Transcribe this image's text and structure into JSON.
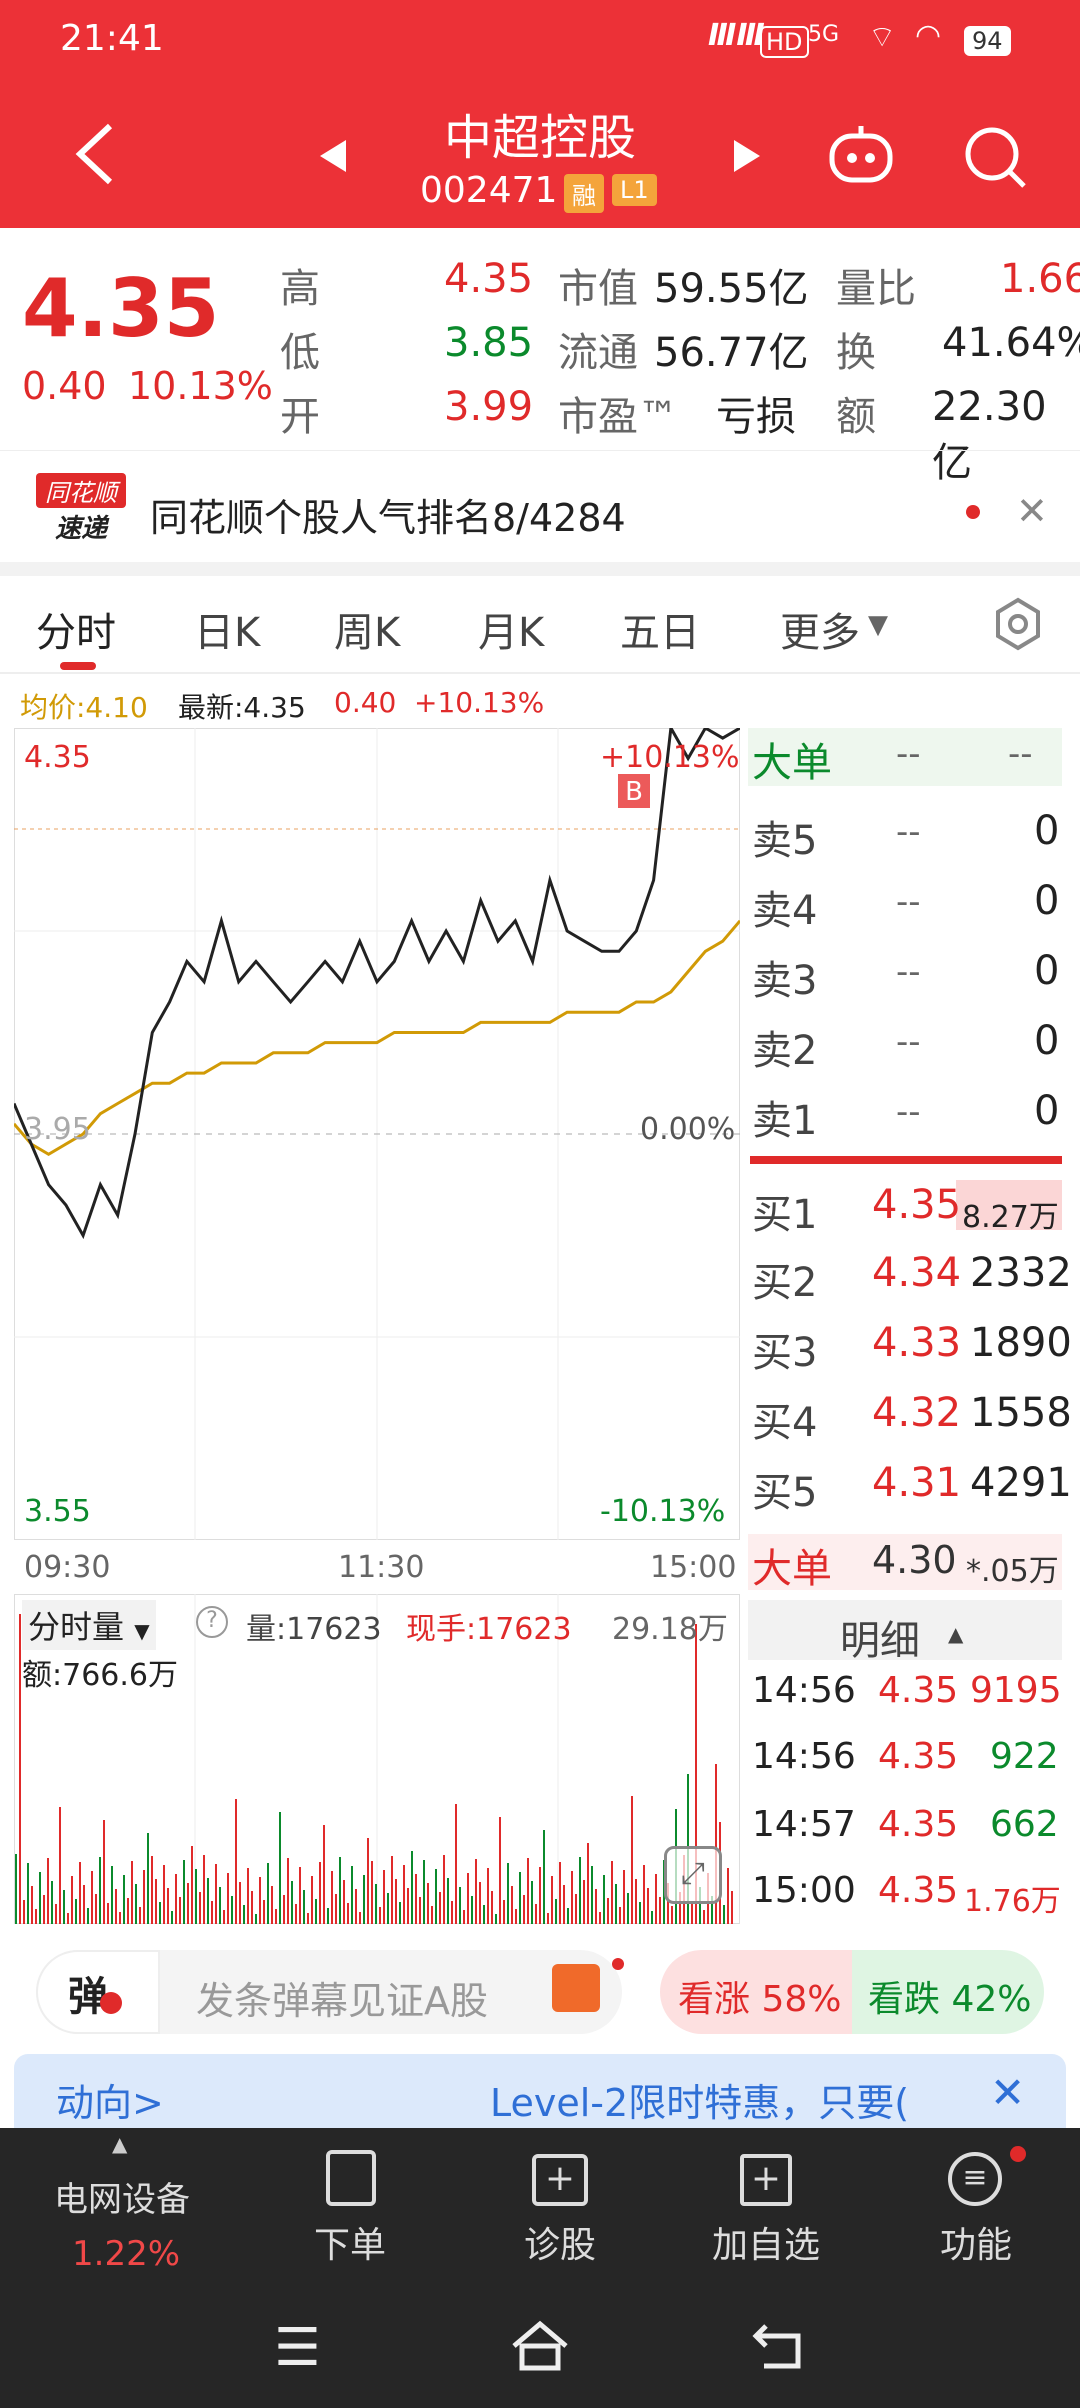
{
  "status": {
    "time": "21:41",
    "battery": "94",
    "signal": "5G",
    "hd": "HD"
  },
  "header": {
    "stock_name": "中超控股",
    "stock_code": "002471",
    "badge_rong": "融",
    "badge_level": "L1"
  },
  "quote": {
    "price": "4.35",
    "change": "0.40",
    "change_pct": "10.13%",
    "high_label": "高",
    "high": "4.35",
    "low_label": "低",
    "low": "3.85",
    "open_label": "开",
    "open": "3.99",
    "mktcap_label": "市值",
    "mktcap": "59.55亿",
    "float_label": "流通",
    "float": "56.77亿",
    "pe_label": "市盈™",
    "pe": "亏损",
    "volratio_label": "量比",
    "volratio": "1.66",
    "turnover_label": "换",
    "turnover": "41.64%",
    "amount_label": "额",
    "amount": "22.30亿"
  },
  "news": {
    "logo_top": "同花顺",
    "logo_bottom": "速递",
    "text": "同花顺个股人气排名8/4284"
  },
  "tabs": [
    "分时",
    "日K",
    "周K",
    "月K",
    "五日",
    "更多"
  ],
  "chart_info": {
    "avg_label": "均价:4.10",
    "latest_label": "最新:4.35",
    "chg": "0.40",
    "chg_pct": "+10.13%"
  },
  "chart_labels": {
    "top_price": "4.35",
    "top_pct": "+10.13%",
    "mid_price": "3.95",
    "mid_pct": "0.00%",
    "bottom_price": "3.55",
    "bottom_pct": "-10.13%",
    "t_open": "09:30",
    "t_mid": "11:30",
    "t_close": "15:00",
    "b_marker": "B"
  },
  "chart_data": {
    "type": "line",
    "ylim": [
      3.55,
      4.35
    ],
    "series": [
      {
        "values": [
          3.98,
          3.94,
          3.9,
          3.88,
          3.85,
          3.9,
          3.87,
          3.95,
          4.05,
          4.08,
          4.12,
          4.1,
          4.16,
          4.1,
          4.12,
          4.1,
          4.08,
          4.1,
          4.12,
          4.1,
          4.14,
          4.1,
          4.12,
          4.16,
          4.12,
          4.15,
          4.12,
          4.18,
          4.14,
          4.16,
          4.12,
          4.2,
          4.15,
          4.14,
          4.13,
          4.13,
          4.15,
          4.2,
          4.35,
          4.32,
          4.35,
          4.34,
          4.35
        ]
      },
      {
        "values": [
          3.96,
          3.94,
          3.93,
          3.94,
          3.95,
          3.97,
          3.98,
          3.99,
          4.0,
          4.0,
          4.01,
          4.01,
          4.02,
          4.02,
          4.02,
          4.03,
          4.03,
          4.03,
          4.04,
          4.04,
          4.04,
          4.04,
          4.05,
          4.05,
          4.05,
          4.05,
          4.05,
          4.06,
          4.06,
          4.06,
          4.06,
          4.06,
          4.07,
          4.07,
          4.07,
          4.07,
          4.08,
          4.08,
          4.09,
          4.11,
          4.13,
          4.14,
          4.16
        ]
      }
    ]
  },
  "volume": {
    "label": "分时量",
    "vol": "量:17623",
    "now": "现手:17623",
    "max": "29.18万",
    "amount": "额:766.6万"
  },
  "orderbook": {
    "big_label": "大单",
    "big_a": "--",
    "big_b": "--",
    "sells": [
      {
        "l": "卖5",
        "p": "--",
        "v": "0"
      },
      {
        "l": "卖4",
        "p": "--",
        "v": "0"
      },
      {
        "l": "卖3",
        "p": "--",
        "v": "0"
      },
      {
        "l": "卖2",
        "p": "--",
        "v": "0"
      },
      {
        "l": "卖1",
        "p": "--",
        "v": "0"
      }
    ],
    "buys": [
      {
        "l": "买1",
        "p": "4.35",
        "v": "8.27万"
      },
      {
        "l": "买2",
        "p": "4.34",
        "v": "2332"
      },
      {
        "l": "买3",
        "p": "4.33",
        "v": "1890"
      },
      {
        "l": "买4",
        "p": "4.32",
        "v": "1558"
      },
      {
        "l": "买5",
        "p": "4.31",
        "v": "4291"
      }
    ],
    "big2_label": "大单",
    "big2_price": "4.30",
    "big2_vol": "*.05万",
    "detail_label": "明细",
    "ticks": [
      {
        "t": "14:56",
        "p": "4.35",
        "v": "9195"
      },
      {
        "t": "14:56",
        "p": "4.35",
        "v": "922"
      },
      {
        "t": "14:57",
        "p": "4.35",
        "v": "662"
      },
      {
        "t": "15:00",
        "p": "4.35",
        "v": "1.76万"
      }
    ]
  },
  "danmu": {
    "button": "弹",
    "placeholder": "发条弹幕见证A股",
    "rise": "看涨 58%",
    "fall": "看跌 42%"
  },
  "promo": {
    "left": "动向>",
    "right": "Level-2限时特惠，只要("
  },
  "bottom_nav": {
    "sector": "电网设备",
    "sector_pct": "1.22%",
    "order": "下单",
    "diag": "诊股",
    "addwatch": "加自选",
    "func": "功能"
  }
}
